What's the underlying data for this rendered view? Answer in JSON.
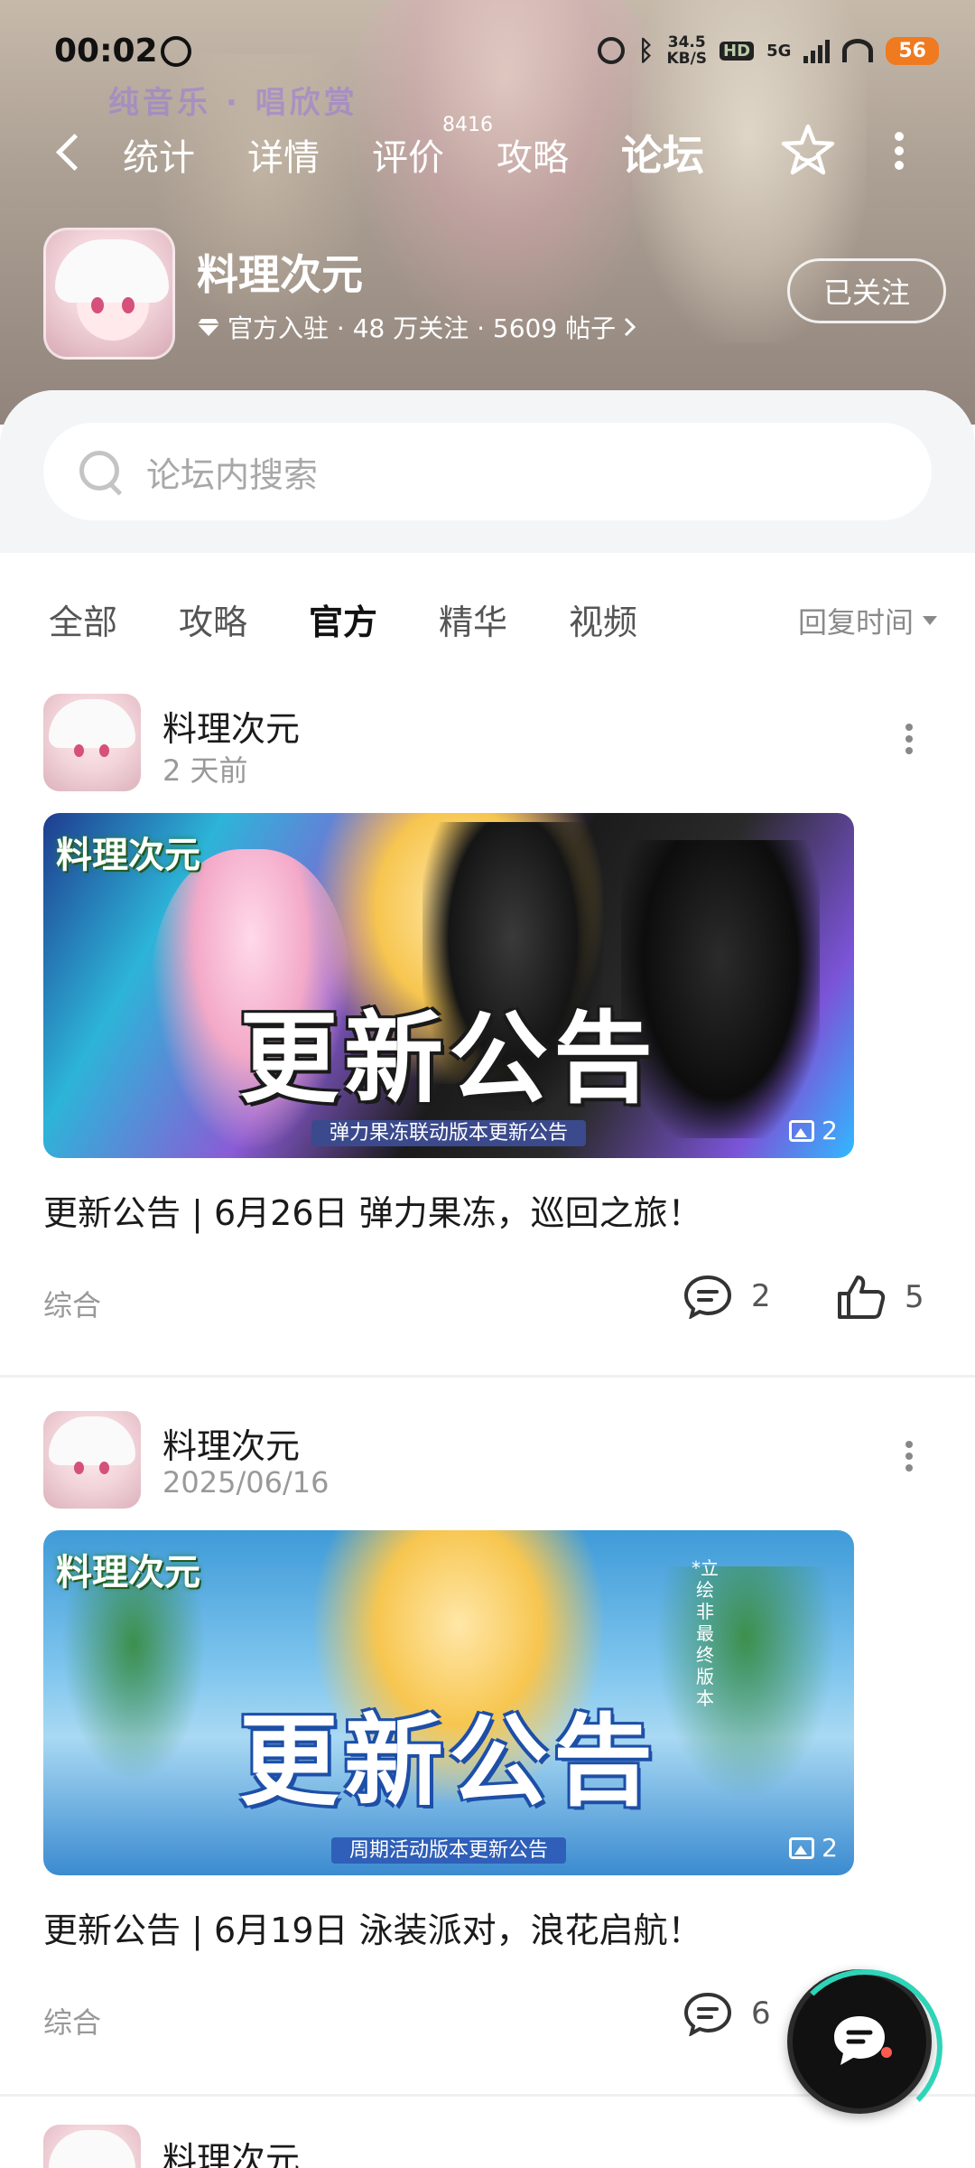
{
  "status_bar": {
    "time": "00:02",
    "net_speed_top": "34.5",
    "net_speed_bottom": "KB/S",
    "hd": "HD",
    "network": "5G",
    "battery": "56"
  },
  "watermark": "纯音乐 · 唱欣赏",
  "nav": {
    "tabs": [
      {
        "label": "统计"
      },
      {
        "label": "详情"
      },
      {
        "label": "评价",
        "badge": "8416"
      },
      {
        "label": "攻略"
      },
      {
        "label": "论坛",
        "active": true
      }
    ]
  },
  "game": {
    "title": "料理次元",
    "meta": "官方入驻 · 48 万关注 · 5609 帖子",
    "follow_label": "已关注"
  },
  "search": {
    "placeholder": "论坛内搜索"
  },
  "filters": {
    "tabs": [
      {
        "label": "全部"
      },
      {
        "label": "攻略"
      },
      {
        "label": "官方",
        "active": true
      },
      {
        "label": "精华"
      },
      {
        "label": "视频"
      }
    ],
    "sort_label": "回复时间"
  },
  "posts": [
    {
      "author": "料理次元",
      "time": "2 天前",
      "image": {
        "logo": "料理次元",
        "headline": "更新公告",
        "subtitle": "弹力果冻联动版本更新公告",
        "count": "2"
      },
      "title": "更新公告 | 6月26日 弹力果冻，巡回之旅！",
      "tag": "综合",
      "comments": "2",
      "likes": "5"
    },
    {
      "author": "料理次元",
      "time": "2025/06/16",
      "image": {
        "logo": "料理次元",
        "headline": "更新公告",
        "subtitle": "周期活动版本更新公告",
        "note": "*立绘非最终版本",
        "count": "2"
      },
      "title": "更新公告 | 6月19日 泳装派对，浪花启航！",
      "tag": "综合",
      "comments": "6"
    },
    {
      "author": "料理次元"
    }
  ],
  "colors": {
    "accent": "#2fd4b8",
    "battery": "#f07a1f"
  }
}
